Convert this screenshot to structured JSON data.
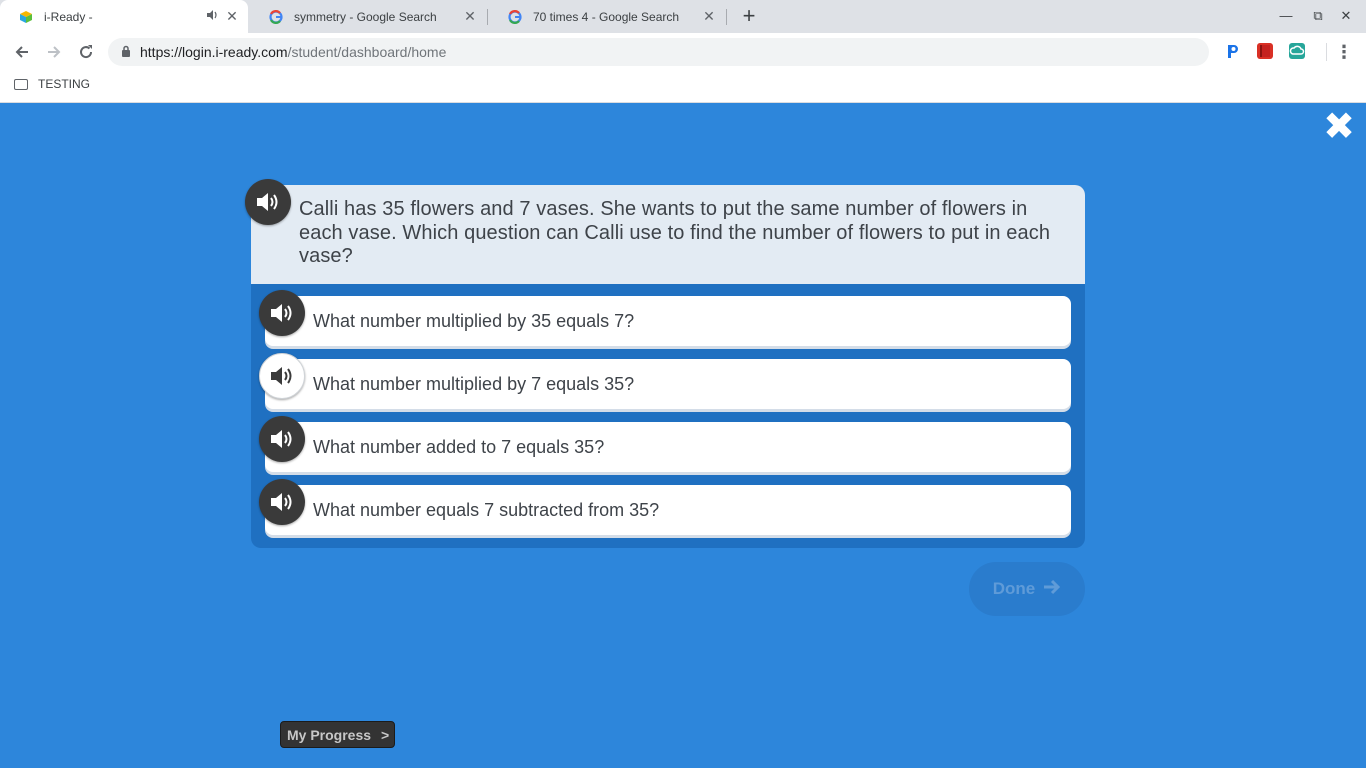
{
  "browser": {
    "tabs": [
      {
        "title": "i-Ready -",
        "favicon": "iready-cube-icon",
        "audio": true,
        "active": true
      },
      {
        "title": "symmetry - Google Search",
        "favicon": "google-g-icon",
        "audio": false,
        "active": false
      },
      {
        "title": "70 times 4 - Google Search",
        "favicon": "google-g-icon",
        "audio": false,
        "active": false
      }
    ],
    "url_host": "https://login.i-ready.com",
    "url_path": "/student/dashboard/home",
    "bookmarks": [
      {
        "label": "TESTING",
        "icon": "folder-icon"
      }
    ],
    "extensions": [
      "pear-deck-icon",
      "red-book-icon",
      "cloud-sync-icon"
    ]
  },
  "lesson": {
    "question": "Calli has 35 flowers and 7 vases. She wants to put the same number of flowers in each vase. Which question can Calli use to find the number of flowers to put in each vase?",
    "answers": [
      {
        "text": "What number multiplied by 35 equals 7?",
        "audio_state": "dark"
      },
      {
        "text": "What number multiplied by 7 equals 35?",
        "audio_state": "light"
      },
      {
        "text": "What number added to 7 equals 35?",
        "audio_state": "dark"
      },
      {
        "text": "What number equals 7 subtracted from 35?",
        "audio_state": "dark"
      }
    ],
    "done_label": "Done",
    "my_progress_label": "My Progress",
    "colors": {
      "background": "#2d86db",
      "card": "#1f70c1",
      "prompt_bg": "#e3ebf3"
    }
  }
}
